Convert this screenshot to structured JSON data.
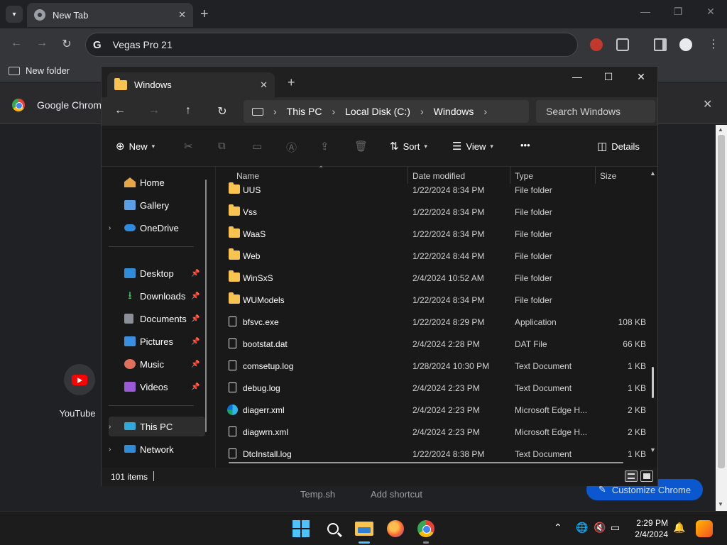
{
  "chrome": {
    "tab_title": "New Tab",
    "omnibox_text": "Vegas Pro 21",
    "bookmark_label": "New folder",
    "banner_text": "Google Chrome",
    "shortcut_label": "YouTube",
    "link_temp": "Temp.sh",
    "link_add": "Add shortcut",
    "customize_label": "Customize Chrome"
  },
  "explorer": {
    "tab_title": "Windows",
    "breadcrumb": [
      "This PC",
      "Local Disk (C:)",
      "Windows"
    ],
    "search_placeholder": "Search Windows",
    "commands": {
      "new": "New",
      "sort": "Sort",
      "view": "View",
      "more": "•••",
      "details": "Details"
    },
    "nav": {
      "home": "Home",
      "gallery": "Gallery",
      "onedrive": "OneDrive",
      "desktop": "Desktop",
      "downloads": "Downloads",
      "documents": "Documents",
      "pictures": "Pictures",
      "music": "Music",
      "videos": "Videos",
      "thispc": "This PC",
      "network": "Network"
    },
    "columns": {
      "name": "Name",
      "date": "Date modified",
      "type": "Type",
      "size": "Size"
    },
    "rows": [
      {
        "name": "UUS",
        "date": "1/22/2024 8:34 PM",
        "type": "File folder",
        "size": "",
        "icon": "folder"
      },
      {
        "name": "Vss",
        "date": "1/22/2024 8:34 PM",
        "type": "File folder",
        "size": "",
        "icon": "folder"
      },
      {
        "name": "WaaS",
        "date": "1/22/2024 8:34 PM",
        "type": "File folder",
        "size": "",
        "icon": "folder"
      },
      {
        "name": "Web",
        "date": "1/22/2024 8:44 PM",
        "type": "File folder",
        "size": "",
        "icon": "folder"
      },
      {
        "name": "WinSxS",
        "date": "2/4/2024 10:52 AM",
        "type": "File folder",
        "size": "",
        "icon": "folder"
      },
      {
        "name": "WUModels",
        "date": "1/22/2024 8:34 PM",
        "type": "File folder",
        "size": "",
        "icon": "folder"
      },
      {
        "name": "bfsvc.exe",
        "date": "1/22/2024 8:29 PM",
        "type": "Application",
        "size": "108 KB",
        "icon": "document"
      },
      {
        "name": "bootstat.dat",
        "date": "2/4/2024 2:28 PM",
        "type": "DAT File",
        "size": "66 KB",
        "icon": "document"
      },
      {
        "name": "comsetup.log",
        "date": "1/28/2024 10:30 PM",
        "type": "Text Document",
        "size": "1 KB",
        "icon": "document"
      },
      {
        "name": "debug.log",
        "date": "2/4/2024 2:23 PM",
        "type": "Text Document",
        "size": "1 KB",
        "icon": "document"
      },
      {
        "name": "diagerr.xml",
        "date": "2/4/2024 2:23 PM",
        "type": "Microsoft Edge H...",
        "size": "2 KB",
        "icon": "edge"
      },
      {
        "name": "diagwrn.xml",
        "date": "2/4/2024 2:23 PM",
        "type": "Microsoft Edge H...",
        "size": "2 KB",
        "icon": "document"
      },
      {
        "name": "DtcInstall.log",
        "date": "1/22/2024 8:38 PM",
        "type": "Text Document",
        "size": "1 KB",
        "icon": "document"
      }
    ],
    "status": "101 items"
  },
  "taskbar": {
    "time": "2:29 PM",
    "date": "2/4/2024"
  },
  "colors": {
    "folder": "#f8c44f",
    "accent": "#4cc2ff",
    "customize_bg": "#0b57d0"
  }
}
